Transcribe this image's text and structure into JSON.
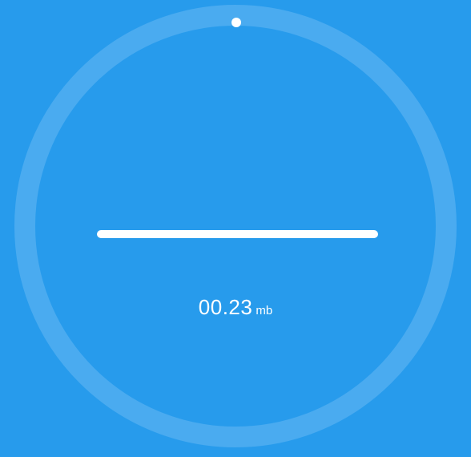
{
  "colors": {
    "background": "#279bec",
    "ring": "#4aabf0",
    "foreground": "#ffffff"
  },
  "progress": {
    "fraction": 0.0
  },
  "readout": {
    "value": "00.23",
    "unit": "mb"
  }
}
